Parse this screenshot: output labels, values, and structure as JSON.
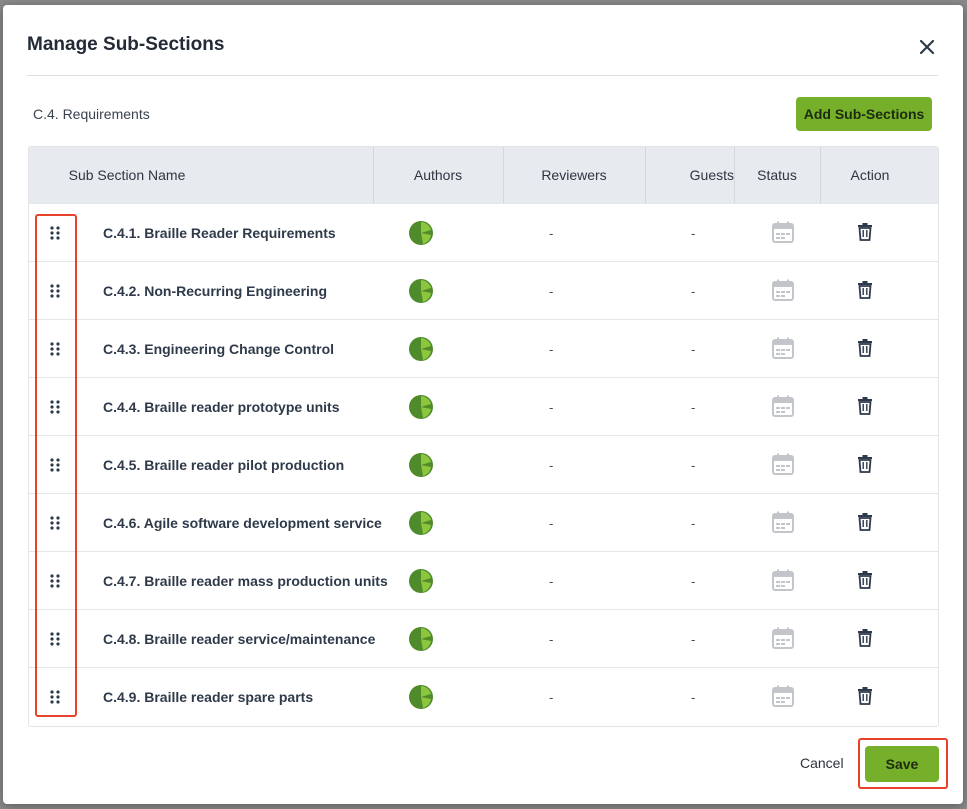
{
  "modal": {
    "title": "Manage Sub-Sections",
    "section_label": "C.4. Requirements",
    "add_button": "Add Sub-Sections",
    "cancel_label": "Cancel",
    "save_label": "Save"
  },
  "table": {
    "columns": [
      "Sub Section Name",
      "Authors",
      "Reviewers",
      "Guests",
      "Status",
      "Action"
    ],
    "rows": [
      {
        "name": "C.4.1. Braille Reader Requirements",
        "reviewers": "-",
        "guests": "-"
      },
      {
        "name": "C.4.2. Non-Recurring Engineering",
        "reviewers": "-",
        "guests": "-"
      },
      {
        "name": "C.4.3. Engineering Change Control",
        "reviewers": "-",
        "guests": "-"
      },
      {
        "name": "C.4.4. Braille reader prototype units",
        "reviewers": "-",
        "guests": "-"
      },
      {
        "name": "C.4.5. Braille reader pilot production",
        "reviewers": "-",
        "guests": "-"
      },
      {
        "name": "C.4.6. Agile software development service",
        "reviewers": "-",
        "guests": "-"
      },
      {
        "name": "C.4.7. Braille reader mass production units",
        "reviewers": "-",
        "guests": "-"
      },
      {
        "name": "C.4.8. Braille reader service/maintenance",
        "reviewers": "-",
        "guests": "-"
      },
      {
        "name": "C.4.9. Braille reader spare parts",
        "reviewers": "-",
        "guests": "-"
      }
    ]
  },
  "icons": {
    "drag": "drag-handle-icon",
    "author": "author-avatar-icon",
    "status": "calendar-icon",
    "action": "trash-icon",
    "close": "close-icon"
  },
  "colors": {
    "accent": "#76b02a",
    "highlight": "#e8412c",
    "avatar": "#4f8a2b"
  }
}
